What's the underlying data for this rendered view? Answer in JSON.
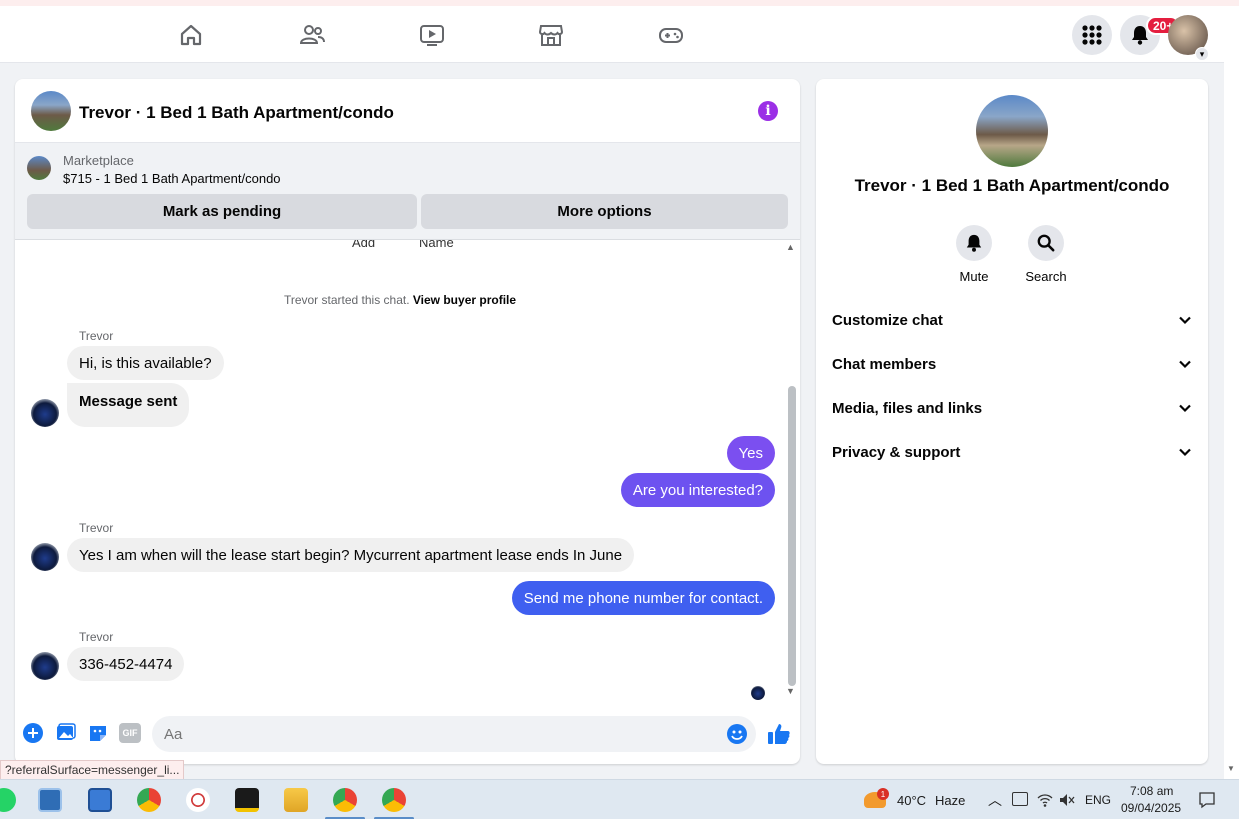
{
  "nav": {
    "icons": [
      "home-icon",
      "friends-icon",
      "video-icon",
      "marketplace-icon",
      "gaming-icon"
    ],
    "notification_badge": "20+"
  },
  "chat": {
    "title": "Trevor · 1 Bed 1 Bath Apartment/condo",
    "marketplace_label": "Marketplace",
    "listing": "$715 - 1 Bed 1 Bath Apartment/condo",
    "mark_pending": "Mark as pending",
    "more_options": "More options",
    "clipped_left": "Add",
    "clipped_right": "Name",
    "system_note_prefix": "Trevor started this chat.",
    "system_note_link": "View buyer profile",
    "messages": [
      {
        "sender": "Trevor",
        "text": "Hi, is this available?"
      },
      {
        "text": "Message sent"
      },
      {
        "text": "Yes"
      },
      {
        "text": "Are you interested?"
      },
      {
        "sender": "Trevor",
        "text": "Yes I am when will the lease start begin? Mycurrent apartment lease ends In June"
      },
      {
        "text": "Send me phone number for contact."
      },
      {
        "sender": "Trevor",
        "text": "336-452-4474"
      }
    ],
    "composer_placeholder": "Aa",
    "gif_label": "GIF"
  },
  "details": {
    "title": "Trevor · 1 Bed 1 Bath Apartment/condo",
    "mute": "Mute",
    "search": "Search",
    "rows": [
      "Customize chat",
      "Chat members",
      "Media, files and links",
      "Privacy & support"
    ]
  },
  "status_url": "?referralSurface=messenger_li...",
  "taskbar": {
    "weather_badge": "1",
    "temperature": "40°C",
    "weather": "Haze",
    "language": "ENG",
    "time": "7:08 am",
    "date": "09/04/2025"
  },
  "colors": {
    "outgoing_purple": "#7b4ff0",
    "outgoing_blue": "#3f5ff0",
    "messenger_blue": "#1877f2",
    "info_purple": "#9b2fe6"
  }
}
